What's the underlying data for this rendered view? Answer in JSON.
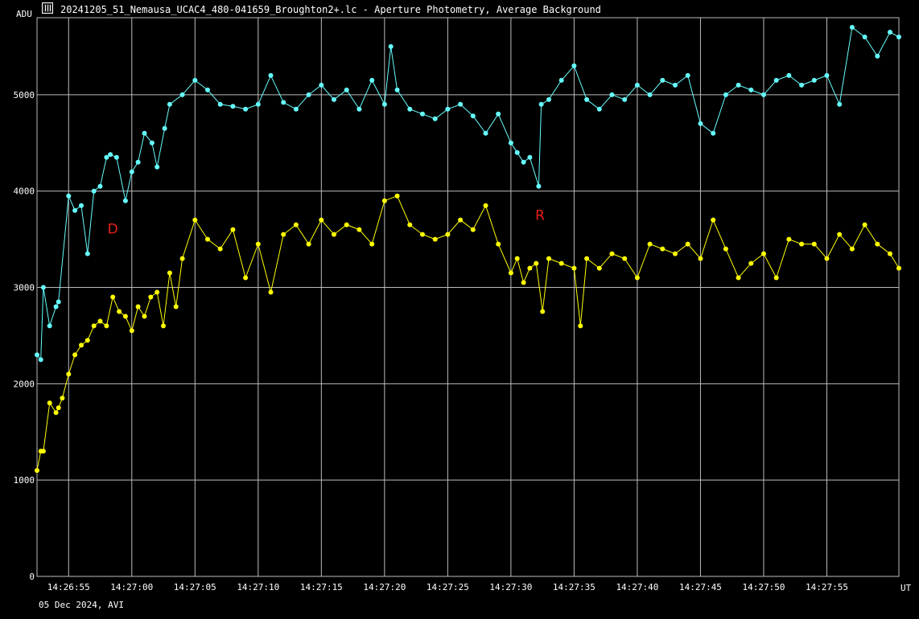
{
  "window": {
    "title": "20241205_51_Nemausa_UCAC4_480-041659_Broughton2+.lc - Aperture Photometry, Average Background",
    "icon": "lightcurve-app-icon"
  },
  "footer": {
    "date_label": "05 Dec 2024, AVI"
  },
  "colors": {
    "background": "#000000",
    "grid": "#bdbdbd",
    "series1": "#66ffff",
    "series2": "#ffff00",
    "event_marker": "#e8201c"
  },
  "chart_data": {
    "type": "line",
    "ylabel": "ADU",
    "xlabel": "UT",
    "ylim": [
      0,
      5800
    ],
    "xlim_seconds": [
      "14:26:52.5",
      "14:28:00.7"
    ],
    "y_ticks": [
      0,
      1000,
      2000,
      3000,
      4000,
      5000
    ],
    "x_tick_labels": [
      "14:26:55",
      "14:27:00",
      "14:27:05",
      "14:27:10",
      "14:27:15",
      "14:27:20",
      "14:27:25",
      "14:27:30",
      "14:27:35",
      "14:27:40",
      "14:27:45",
      "14:27:50",
      "14:27:55"
    ],
    "grid": true,
    "annotations": [
      {
        "text": "D",
        "x": "14:26:58.5",
        "y": 3560
      },
      {
        "text": "R",
        "x": "14:27:32.3",
        "y": 3700
      }
    ],
    "series": [
      {
        "name": "",
        "color": "#66ffff",
        "x": [
          "14:26:52.5",
          "14:26:52.8",
          "14:26:53.0",
          "14:26:53.5",
          "14:26:54.0",
          "14:26:54.2",
          "14:26:55.0",
          "14:26:55.5",
          "14:26:56.0",
          "14:26:56.5",
          "14:26:57.0",
          "14:26:57.5",
          "14:26:58.0",
          "14:26:58.3",
          "14:26:58.8",
          "14:26:59.5",
          "14:27:00.0",
          "14:27:00.5",
          "14:27:01.0",
          "14:27:01.6",
          "14:27:02.0",
          "14:27:02.6",
          "14:27:03.0",
          "14:27:04.0",
          "14:27:05.0",
          "14:27:06.0",
          "14:27:07.0",
          "14:27:08.0",
          "14:27:09.0",
          "14:27:10.0",
          "14:27:11.0",
          "14:27:12.0",
          "14:27:13.0",
          "14:27:14.0",
          "14:27:15.0",
          "14:27:16.0",
          "14:27:17.0",
          "14:27:18.0",
          "14:27:19.0",
          "14:27:20.0",
          "14:27:20.5",
          "14:27:21.0",
          "14:27:22.0",
          "14:27:23.0",
          "14:27:24.0",
          "14:27:25.0",
          "14:27:26.0",
          "14:27:27.0",
          "14:27:28.0",
          "14:27:29.0",
          "14:27:30.0",
          "14:27:30.5",
          "14:27:31.0",
          "14:27:31.5",
          "14:27:32.2",
          "14:27:32.4",
          "14:27:33.0",
          "14:27:34.0",
          "14:27:35.0",
          "14:27:36.0",
          "14:27:37.0",
          "14:27:38.0",
          "14:27:39.0",
          "14:27:40.0",
          "14:27:41.0",
          "14:27:42.0",
          "14:27:43.0",
          "14:27:44.0",
          "14:27:45.0",
          "14:27:46.0",
          "14:27:47.0",
          "14:27:48.0",
          "14:27:49.0",
          "14:27:50.0",
          "14:27:51.0",
          "14:27:52.0",
          "14:27:53.0",
          "14:27:54.0",
          "14:27:55.0",
          "14:27:56.0",
          "14:27:57.0",
          "14:27:58.0",
          "14:27:59.0",
          "14:28:00.0",
          "14:28:00.7"
        ],
        "y": [
          2300,
          2250,
          3000,
          2600,
          2800,
          2850,
          3950,
          3800,
          3850,
          3350,
          4000,
          4050,
          4350,
          4380,
          4350,
          3900,
          4200,
          4300,
          4600,
          4500,
          4250,
          4650,
          4900,
          5000,
          5150,
          5050,
          4900,
          4880,
          4850,
          4900,
          5200,
          4920,
          4850,
          5000,
          5100,
          4950,
          5050,
          4850,
          5150,
          4900,
          5500,
          5050,
          4850,
          4800,
          4750,
          4850,
          4900,
          4780,
          4600,
          4800,
          4500,
          4400,
          4300,
          4350,
          4050,
          4900,
          4950,
          5150,
          5300,
          4950,
          4850,
          5000,
          4950,
          5100,
          5000,
          5150,
          5100,
          5200,
          4700,
          4600,
          5000,
          5100,
          5050,
          5000,
          5150,
          5200,
          5100,
          5150,
          5200,
          4900,
          5700,
          5600,
          5400,
          5650,
          5600
        ]
      },
      {
        "name": "",
        "color": "#ffff00",
        "x": [
          "14:26:52.5",
          "14:26:52.8",
          "14:26:53.0",
          "14:26:53.5",
          "14:26:54.0",
          "14:26:54.2",
          "14:26:54.5",
          "14:26:55.0",
          "14:26:55.5",
          "14:26:56.0",
          "14:26:56.5",
          "14:26:57.0",
          "14:26:57.5",
          "14:26:58.0",
          "14:26:58.5",
          "14:26:59.0",
          "14:26:59.5",
          "14:27:00.0",
          "14:27:00.5",
          "14:27:01.0",
          "14:27:01.5",
          "14:27:02.0",
          "14:27:02.5",
          "14:27:03.0",
          "14:27:03.5",
          "14:27:04.0",
          "14:27:05.0",
          "14:27:06.0",
          "14:27:07.0",
          "14:27:08.0",
          "14:27:09.0",
          "14:27:10.0",
          "14:27:11.0",
          "14:27:12.0",
          "14:27:13.0",
          "14:27:14.0",
          "14:27:15.0",
          "14:27:16.0",
          "14:27:17.0",
          "14:27:18.0",
          "14:27:19.0",
          "14:27:20.0",
          "14:27:21.0",
          "14:27:22.0",
          "14:27:23.0",
          "14:27:24.0",
          "14:27:25.0",
          "14:27:26.0",
          "14:27:27.0",
          "14:27:28.0",
          "14:27:29.0",
          "14:27:30.0",
          "14:27:30.5",
          "14:27:31.0",
          "14:27:31.5",
          "14:27:32.0",
          "14:27:32.5",
          "14:27:33.0",
          "14:27:34.0",
          "14:27:35.0",
          "14:27:35.5",
          "14:27:36.0",
          "14:27:37.0",
          "14:27:38.0",
          "14:27:39.0",
          "14:27:40.0",
          "14:27:41.0",
          "14:27:42.0",
          "14:27:43.0",
          "14:27:44.0",
          "14:27:45.0",
          "14:27:46.0",
          "14:27:47.0",
          "14:27:48.0",
          "14:27:49.0",
          "14:27:50.0",
          "14:27:51.0",
          "14:27:52.0",
          "14:27:53.0",
          "14:27:54.0",
          "14:27:55.0",
          "14:27:56.0",
          "14:27:57.0",
          "14:27:58.0",
          "14:27:59.0",
          "14:28:00.0",
          "14:28:00.7"
        ],
        "y": [
          1100,
          1300,
          1300,
          1800,
          1700,
          1750,
          1850,
          2100,
          2300,
          2400,
          2450,
          2600,
          2650,
          2600,
          2900,
          2750,
          2700,
          2550,
          2800,
          2700,
          2900,
          2950,
          2600,
          3150,
          2800,
          3300,
          3700,
          3500,
          3400,
          3600,
          3100,
          3450,
          2950,
          3550,
          3650,
          3450,
          3700,
          3550,
          3650,
          3600,
          3450,
          3900,
          3950,
          3650,
          3550,
          3500,
          3550,
          3700,
          3600,
          3850,
          3450,
          3150,
          3300,
          3050,
          3200,
          3250,
          2750,
          3300,
          3250,
          3200,
          2600,
          3300,
          3200,
          3350,
          3300,
          3100,
          3450,
          3400,
          3350,
          3450,
          3300,
          3700,
          3400,
          3100,
          3250,
          3350,
          3100,
          3500,
          3450,
          3450,
          3300,
          3550,
          3400,
          3650,
          3450,
          3350,
          3200
        ]
      }
    ]
  }
}
